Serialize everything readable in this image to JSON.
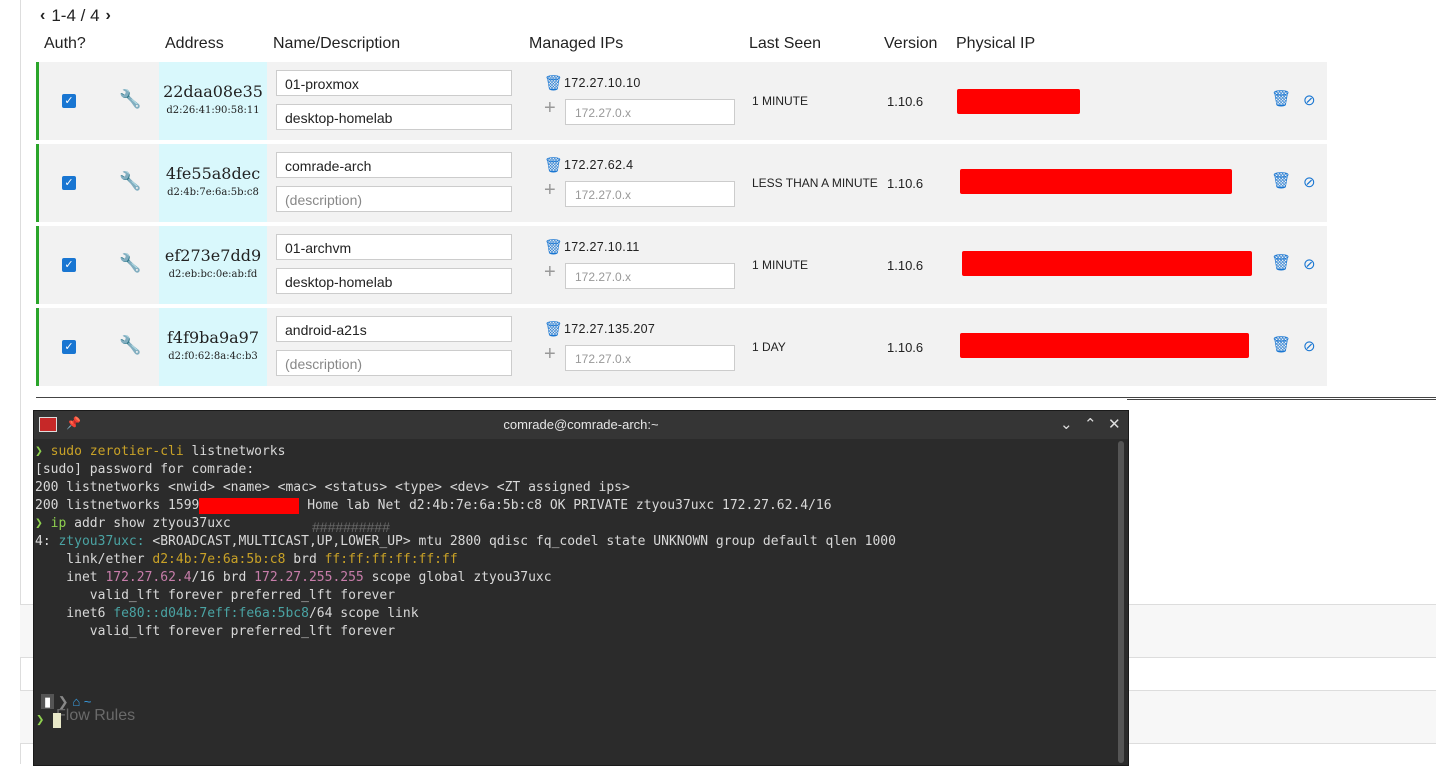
{
  "pager": {
    "text": "1-4 / 4",
    "prev": "‹",
    "next": "›"
  },
  "headers": {
    "auth": "Auth?",
    "address": "Address",
    "name": "Name/Description",
    "managed": "Managed IPs",
    "last_seen": "Last Seen",
    "version": "Version",
    "physical": "Physical IP"
  },
  "members": [
    {
      "id": "22daa08e35",
      "mac": "d2:26:41:90:58:11",
      "name": "01-proxmox",
      "description": "desktop-homelab",
      "ip": "172.27.10.10",
      "ip_placeholder": "172.27.0.x",
      "last_seen": "1 MINUTE",
      "version": "1.10.6"
    },
    {
      "id": "4fe55a8dec",
      "mac": "d2:4b:7e:6a:5b:c8",
      "name": "comrade-arch",
      "description": "(description)",
      "ip": "172.27.62.4",
      "ip_placeholder": "172.27.0.x",
      "last_seen": "LESS THAN A MINUTE",
      "version": "1.10.6"
    },
    {
      "id": "ef273e7dd9",
      "mac": "d2:eb:bc:0e:ab:fd",
      "name": "01-archvm",
      "description": "desktop-homelab",
      "ip": "172.27.10.11",
      "ip_placeholder": "172.27.0.x",
      "last_seen": "1 MINUTE",
      "version": "1.10.6"
    },
    {
      "id": "f4f9ba9a97",
      "mac": "d2:f0:62:8a:4c:b3",
      "name": "android-a21s",
      "description": "(description)",
      "ip": "172.27.135.207",
      "ip_placeholder": "172.27.0.x",
      "last_seen": "1 DAY",
      "version": "1.10.6"
    }
  ],
  "terminal": {
    "title": "comrade@comrade-arch:~",
    "lines": {
      "l1_cmd": "sudo zerotier-cli",
      "l1_arg": " listnetworks",
      "l2": "[sudo] password for comrade:",
      "l3": "200 listnetworks <nwid> <name> <mac> <status> <type> <dev> <ZT assigned ips>",
      "l4_a": "200 listnetworks 1599",
      "l4_b": " Home lab Net d2:4b:7e:6a:5b:c8 OK PRIVATE ztyou37uxc 172.27.62.4/16",
      "l5_cmd": "ip",
      "l5_arg": " addr show ztyou37uxc",
      "l6_a": "4: ",
      "l6_dev": "ztyou37uxc:",
      "l6_b": " <BROADCAST,MULTICAST,UP,LOWER_UP> mtu 2800 qdisc fq_codel state UNKNOWN group default qlen 1000",
      "l7_a": "    link/ether ",
      "l7_mac": "d2:4b:7e:6a:5b:c8",
      "l7_b": " brd ",
      "l7_brd": "ff:ff:ff:ff:ff:ff",
      "l8_a": "    inet ",
      "l8_ip": "172.27.62.4",
      "l8_b": "/16 brd ",
      "l8_brd": "172.27.255.255",
      "l8_c": " scope global ztyou37uxc",
      "l9": "       valid_lft forever preferred_lft forever",
      "l10_a": "    inet6 ",
      "l10_ip": "fe80::d04b:7eff:fe6a:5bc8",
      "l10_b": "/64 scope link",
      "l11": "       valid_lft forever preferred_lft forever"
    },
    "prompt_path": "~",
    "behind_text": {
      "flow_rules": "Flow Rules",
      "hash": "##########"
    }
  }
}
